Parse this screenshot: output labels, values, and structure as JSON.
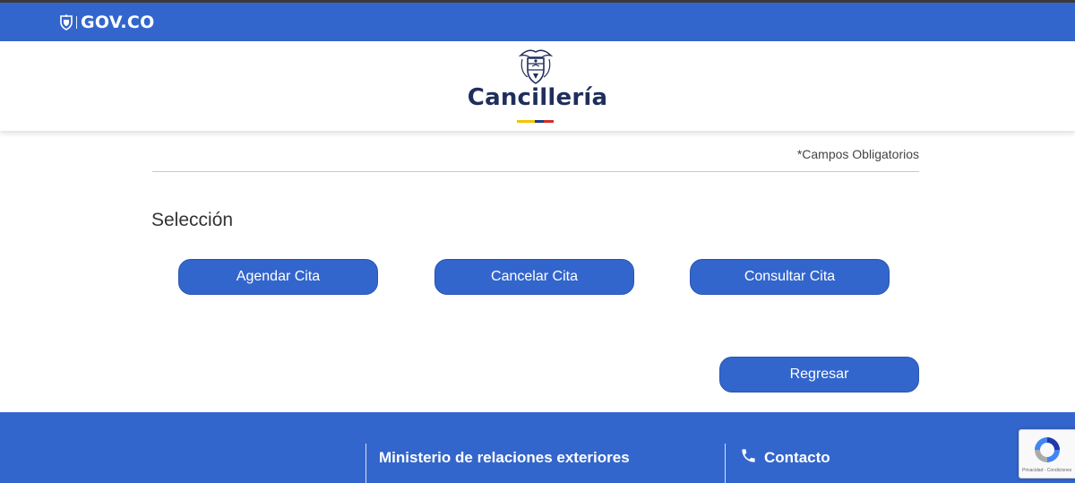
{
  "gov_bar": {
    "logo_text": "GOV.CO",
    "icon": "colombia-shield-icon"
  },
  "header": {
    "crest_icon": "colombia-coat-of-arms-icon",
    "brand": "Cancillería",
    "flag_colors": [
      "#f3c300",
      "#1f3c88",
      "#d42b2b"
    ]
  },
  "form": {
    "required_note": "*Campos Obligatorios",
    "section_title": "Selección",
    "buttons": {
      "agendar": "Agendar Cita",
      "cancelar": "Cancelar Cita",
      "consultar": "Consultar Cita",
      "regresar": "Regresar"
    }
  },
  "footer": {
    "ministry_title": "Ministerio de relaciones exteriores",
    "contact_title": "Contacto",
    "contact_icon": "phone-icon"
  },
  "recaptcha": {
    "icon": "recaptcha-icon",
    "links": "Privacidad - Condiciones"
  },
  "colors": {
    "primary": "#3366cc",
    "brand_text": "#1f2e5c"
  }
}
